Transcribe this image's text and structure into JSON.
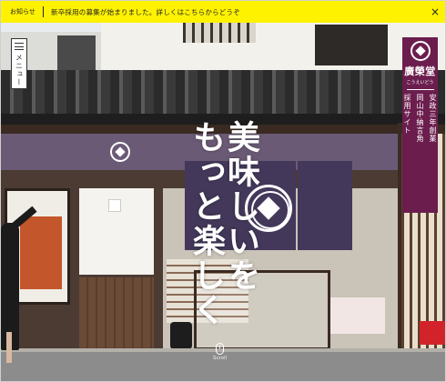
{
  "notice": {
    "tag": "お知らせ",
    "text": "新卒採用の募集が始まりました。詳しくはこちらからどうぞ",
    "close_icon": "close-icon"
  },
  "menu": {
    "label": "メニュー",
    "icon": "hamburger-icon"
  },
  "hero": {
    "headline_lines": [
      "美味しいを",
      "もっと楽しく"
    ]
  },
  "brand": {
    "logo_icon": "crest-logo-icon",
    "name": "廣榮堂",
    "ruby": "こうえいどう",
    "links": [
      "安政三年創業",
      "岡山中納言角",
      "採用サイト"
    ]
  },
  "scroll": {
    "label": "Scroll",
    "icon": "mouse-scroll-icon"
  },
  "colors": {
    "notice_bg": "#fff200",
    "brand_bg": "#6b1e4d",
    "noren": "#43385a"
  }
}
